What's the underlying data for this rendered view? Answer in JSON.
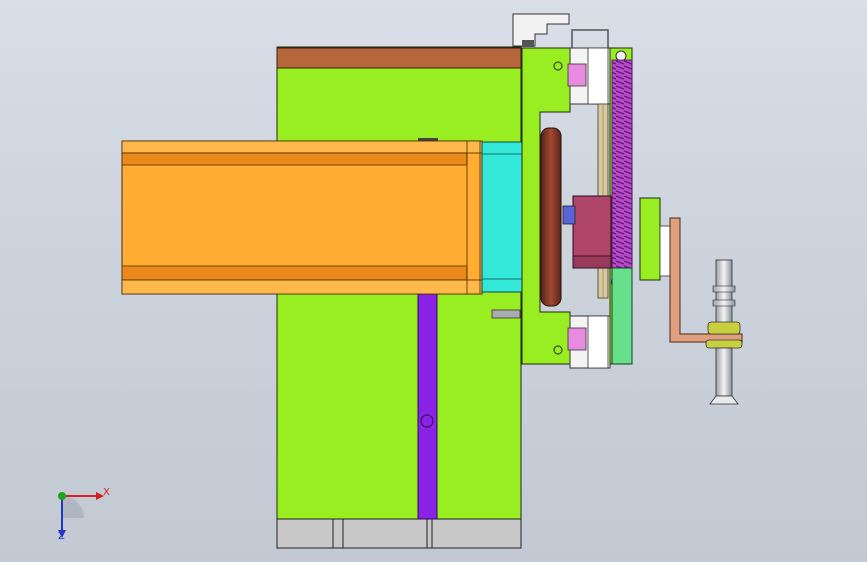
{
  "viewport": {
    "background_top": "#d9dee7",
    "background_bottom": "#c2c9d3"
  },
  "triad": {
    "x_label": "X",
    "y_label": "Y",
    "z_label": "Z",
    "x_color": "#d42020",
    "y_color": "#1fa21f",
    "z_color": "#2036c8"
  },
  "model": {
    "colors": {
      "base_plate": "#99ee22",
      "top_bar": "#b5663b",
      "cylinder_body": "#ffad33",
      "cylinder_end": "#33e8d8",
      "purple_strip": "#8a22e8",
      "bottom_blocks": "#c8c8c8",
      "wheel": "#7a3524",
      "slider_block": "#b0456a",
      "spring": "#b44bc8",
      "rail": "#66e08a",
      "bracket": "#e0a080",
      "pin": "#d9dde2"
    }
  }
}
